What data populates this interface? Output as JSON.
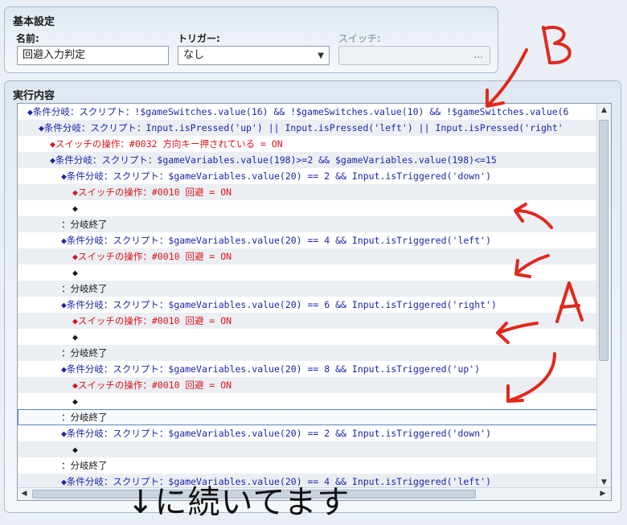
{
  "basic": {
    "title": "基本設定",
    "name_label": "名前:",
    "name_value": "回避入力判定",
    "trigger_label": "トリガー:",
    "trigger_value": "なし",
    "switch_label": "スイッチ:",
    "switch_button": "..."
  },
  "contents": {
    "title": "実行内容",
    "rows": [
      {
        "indent": 0,
        "color": "blue",
        "alt": false,
        "text": "◆条件分岐：スクリプト：!$gameSwitches.value(16) && !$gameSwitches.value(10) && !$gameSwitches.value(6"
      },
      {
        "indent": 1,
        "color": "blue",
        "alt": true,
        "text": "◆条件分岐：スクリプト：Input.isPressed('up') || Input.isPressed('left') || Input.isPressed('right'"
      },
      {
        "indent": 2,
        "color": "red",
        "alt": false,
        "text": "◆スイッチの操作：#0032 方向キー押されている = ON"
      },
      {
        "indent": 2,
        "color": "blue",
        "alt": true,
        "text": "◆条件分岐：スクリプト：$gameVariables.value(198)>=2 && $gameVariables.value(198)<=15"
      },
      {
        "indent": 3,
        "color": "blue",
        "alt": false,
        "text": "◆条件分岐：スクリプト：$gameVariables.value(20) == 2 && Input.isTriggered('down')"
      },
      {
        "indent": 4,
        "color": "red",
        "alt": true,
        "text": "◆スイッチの操作：#0010 回避 = ON"
      },
      {
        "indent": 4,
        "color": "dark",
        "alt": false,
        "text": "◆"
      },
      {
        "indent": 3,
        "color": "dark",
        "alt": true,
        "text": "：分岐終了"
      },
      {
        "indent": 3,
        "color": "blue",
        "alt": false,
        "text": "◆条件分岐：スクリプト：$gameVariables.value(20) == 4 && Input.isTriggered('left')"
      },
      {
        "indent": 4,
        "color": "red",
        "alt": true,
        "text": "◆スイッチの操作：#0010 回避 = ON"
      },
      {
        "indent": 4,
        "color": "dark",
        "alt": false,
        "text": "◆"
      },
      {
        "indent": 3,
        "color": "dark",
        "alt": true,
        "text": "：分岐終了"
      },
      {
        "indent": 3,
        "color": "blue",
        "alt": false,
        "text": "◆条件分岐：スクリプト：$gameVariables.value(20) == 6 && Input.isTriggered('right')"
      },
      {
        "indent": 4,
        "color": "red",
        "alt": true,
        "text": "◆スイッチの操作：#0010 回避 = ON"
      },
      {
        "indent": 4,
        "color": "dark",
        "alt": false,
        "text": "◆"
      },
      {
        "indent": 3,
        "color": "dark",
        "alt": true,
        "text": "：分岐終了"
      },
      {
        "indent": 3,
        "color": "blue",
        "alt": false,
        "text": "◆条件分岐：スクリプト：$gameVariables.value(20) == 8 && Input.isTriggered('up')"
      },
      {
        "indent": 4,
        "color": "red",
        "alt": true,
        "text": "◆スイッチの操作：#0010 回避 = ON"
      },
      {
        "indent": 4,
        "color": "dark",
        "alt": false,
        "text": "◆"
      },
      {
        "indent": 3,
        "color": "dark",
        "alt": true,
        "selected": true,
        "text": "：分岐終了"
      },
      {
        "indent": 3,
        "color": "blue",
        "alt": false,
        "text": "◆条件分岐：スクリプト：$gameVariables.value(20) == 2 && Input.isTriggered('down')"
      },
      {
        "indent": 4,
        "color": "dark",
        "alt": true,
        "text": "◆"
      },
      {
        "indent": 3,
        "color": "dark",
        "alt": false,
        "text": "：分岐終了"
      },
      {
        "indent": 3,
        "color": "blue",
        "alt": true,
        "text": "◆条件分岐：スクリプト：$gameVariables.value(20) == 4 && Input.isTriggered('left')"
      }
    ]
  },
  "annotations": {
    "label_b": "B",
    "label_a": "A",
    "note": "↓に続いてます",
    "ink_color": "#e0281e"
  },
  "colors": {
    "blue_text": "#1d25a8",
    "red_text": "#d8141c"
  }
}
